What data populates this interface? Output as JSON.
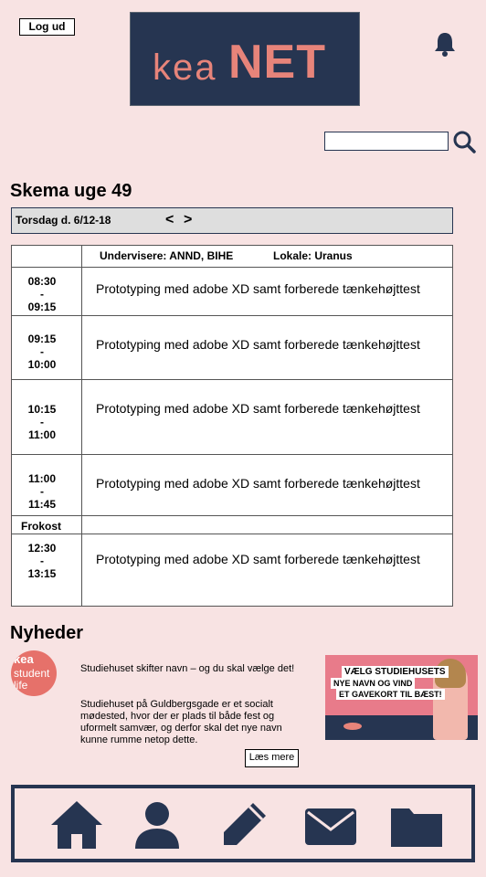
{
  "header": {
    "logout_label": "Log ud",
    "logo_text_left": "kea",
    "logo_text_right": "NET",
    "search": {
      "value": "",
      "placeholder": ""
    }
  },
  "schedule": {
    "title": "Skema uge 49",
    "day_label": "Torsdag d. 6/12-18",
    "prev_label": "<",
    "next_label": ">",
    "teachers": "Undervisere: ANND, BIHE",
    "room": "Lokale: Uranus",
    "lunch_label": "Frokost",
    "slots": [
      {
        "start": "08:30",
        "sep": "-",
        "end": "09:15",
        "topic": "Prototyping med adobe XD samt forberede tænkehøjttest"
      },
      {
        "start": "09:15",
        "sep": "-",
        "end": "10:00",
        "topic": "Prototyping med adobe XD samt forberede tænkehøjttest"
      },
      {
        "start": "10:15",
        "sep": "-",
        "end": "11:00",
        "topic": "Prototyping med adobe XD samt forberede tænkehøjttest"
      },
      {
        "start": "11:00",
        "sep": "-",
        "end": "11:45",
        "topic": "Prototyping med adobe XD samt forberede tænkehøjttest"
      },
      {
        "start": "12:30",
        "sep": "-",
        "end": "13:15",
        "topic": "Prototyping med adobe XD samt forberede tænkehøjttest"
      }
    ]
  },
  "news": {
    "title": "Nyheder",
    "badge": {
      "line1": "kea",
      "line2": "student",
      "line3": "life"
    },
    "headline": "Studiehuset skifter navn – og du skal vælge det!",
    "body": "Studiehuset på Guldbergsgade er et socialt mødested, hvor der er plads til både fest og uformelt samvær, og derfor skal det nye navn kunne rumme netop dette.",
    "read_more_label": "Læs mere",
    "image": {
      "line1": "VÆLG STUDIEHUSETS",
      "line2": "NYE NAVN OG VIND",
      "line3": "ET GAVEKORT TIL BÆST!"
    }
  },
  "nav": {
    "items": [
      {
        "icon": "home-icon"
      },
      {
        "icon": "profile-icon"
      },
      {
        "icon": "edit-icon"
      },
      {
        "icon": "mail-icon"
      },
      {
        "icon": "folder-icon"
      }
    ]
  },
  "colors": {
    "background": "#f8e3e3",
    "navy": "#263551",
    "accent": "#e7847a",
    "table_bg": "#ffffff",
    "daybar": "#dedede"
  }
}
